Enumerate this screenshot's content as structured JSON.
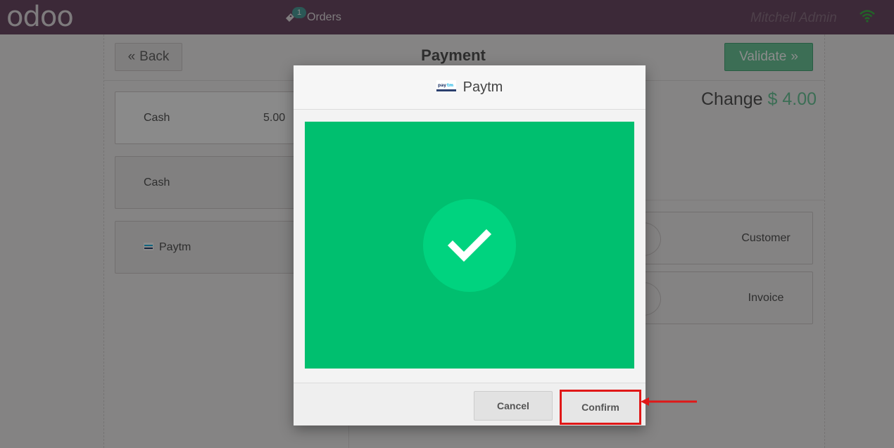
{
  "topbar": {
    "logo": "odoo",
    "orders_label": "Orders",
    "orders_count": "1",
    "user": "Mitchell Admin"
  },
  "payment": {
    "back_label": "Back",
    "title": "Payment",
    "validate_label": "Validate",
    "lines": [
      {
        "label": "Cash",
        "amount": "5.00"
      },
      {
        "label": "Cash",
        "amount": ""
      },
      {
        "label": "Paytm",
        "amount": ""
      }
    ],
    "change_label": "Change",
    "change_amount": "$ 4.00",
    "customer_label": "Customer",
    "invoice_label": "Invoice"
  },
  "modal": {
    "title": "Paytm",
    "cancel_label": "Cancel",
    "confirm_label": "Confirm"
  },
  "colors": {
    "topbar": "#6e4c66",
    "success_green": "#00bf6f",
    "validate_green": "#6ec89b",
    "highlight_red": "#e01818"
  }
}
